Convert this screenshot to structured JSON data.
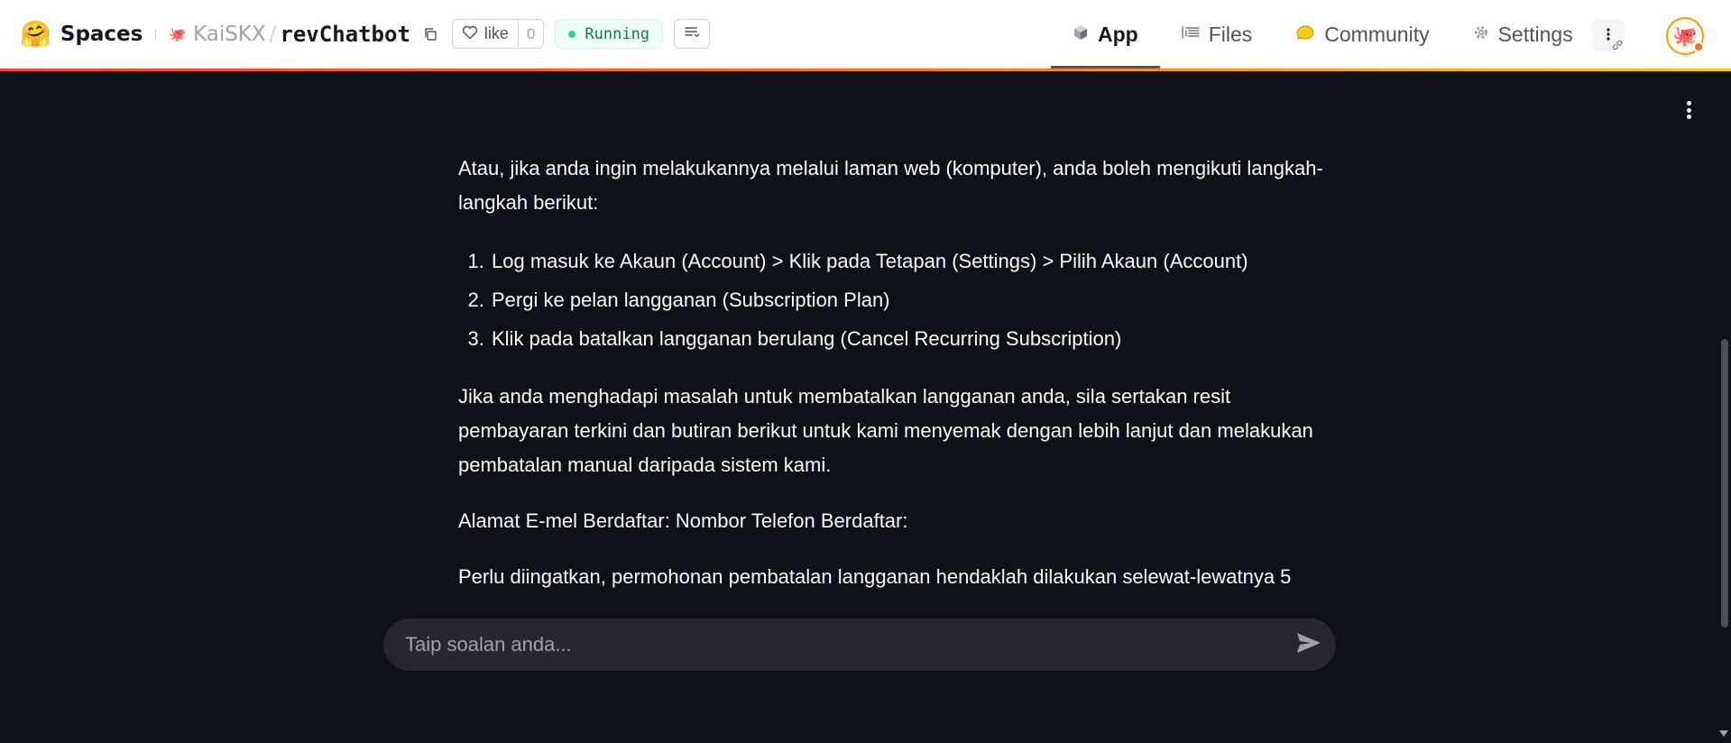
{
  "header": {
    "brand": "Spaces",
    "owner": "KaiSKX",
    "separator": "/",
    "repo_name": "revChatbot",
    "like_label": "like",
    "like_count": "0",
    "status": "Running",
    "colors": {
      "status_bg": "#ecfdf5",
      "status_text": "#15803d",
      "accent_start": "#ef4444",
      "accent_end": "#facc15"
    }
  },
  "tabs": [
    {
      "label": "App",
      "icon": "cube-icon",
      "active": true
    },
    {
      "label": "Files",
      "icon": "files-icon",
      "active": false
    },
    {
      "label": "Community",
      "icon": "community-icon",
      "active": false
    },
    {
      "label": "Settings",
      "icon": "gear-icon",
      "active": false
    }
  ],
  "chat": {
    "intro": "Atau, jika anda ingin melakukannya melalui laman web (komputer), anda boleh mengikuti langkah-langkah berikut:",
    "steps": [
      "Log masuk ke Akaun (Account) > Klik pada Tetapan (Settings) > Pilih Akaun (Account)",
      "Pergi ke pelan langganan (Subscription Plan)",
      "Klik pada batalkan langganan berulang (Cancel Recurring Subscription)"
    ],
    "para2": "Jika anda menghadapi masalah untuk membatalkan langganan anda, sila sertakan resit pembayaran terkini dan butiran berikut untuk kami menyemak dengan lebih lanjut dan melakukan pembatalan manual daripada sistem kami.",
    "para3": "Alamat E-mel Berdaftar: Nombor Telefon Berdaftar:",
    "para4": "Perlu diingatkan, permohonan pembatalan langganan hendaklah dilakukan selewat-lewatnya 5"
  },
  "input": {
    "placeholder": "Taip soalan anda...",
    "value": ""
  },
  "theme": {
    "app_bg": "#0e1117",
    "input_bg": "#262730",
    "text": "#fafafa"
  }
}
